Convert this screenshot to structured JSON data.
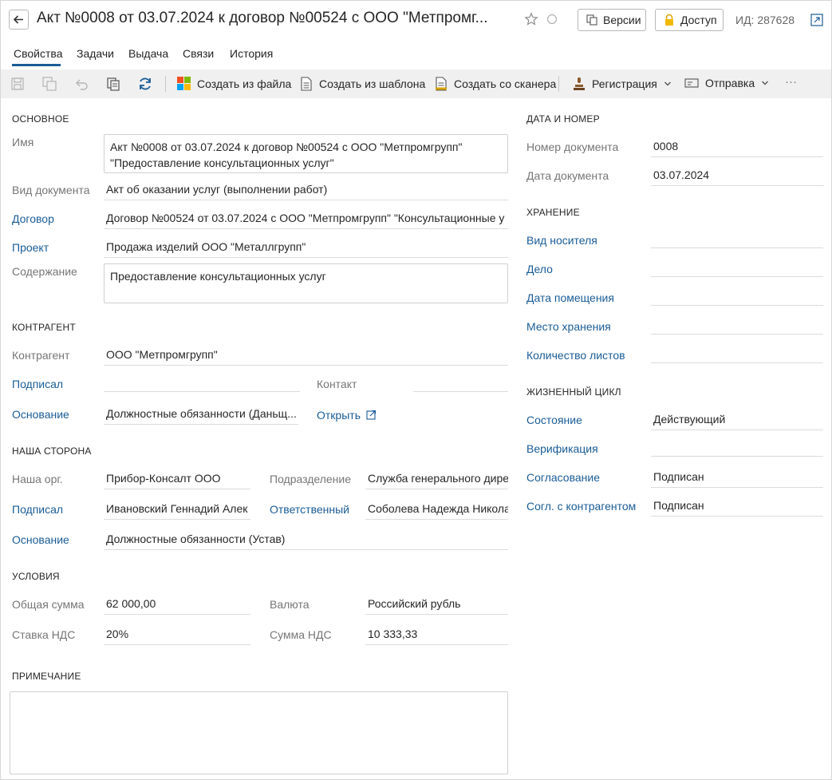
{
  "header": {
    "title": "Акт №0008 от 03.07.2024 к договор №00524 с ООО \"Метпромг...",
    "versions_label": "Версии",
    "access_label": "Доступ",
    "id_text": "ИД: 287628"
  },
  "tabs": [
    {
      "label": "Свойства"
    },
    {
      "label": "Задачи"
    },
    {
      "label": "Выдача"
    },
    {
      "label": "Связи"
    },
    {
      "label": "История"
    }
  ],
  "toolbar": {
    "create_from_file": "Создать из файла",
    "create_from_template": "Создать из шаблона",
    "create_from_scanner": "Создать со сканера",
    "registration": "Регистрация",
    "sending": "Отправка",
    "more": "···"
  },
  "basic": {
    "section": "ОСНОВНОЕ",
    "name_label": "Имя",
    "name_line1": "Акт №0008 от 03.07.2024 к договор №00524 с ООО \"Метпромгрупп\"",
    "name_line2": "\"Предоставление консультационных услуг\"",
    "doc_kind_label": "Вид документа",
    "doc_kind_value": "Акт об оказании услуг (выполнении работ)",
    "contract_label": "Договор",
    "contract_value": "Договор №00524 от 03.07.2024 с ООО \"Метпромгрупп\" \"Консультационные у",
    "project_label": "Проект",
    "project_value": "Продажа изделий ООО \"Металлгрупп\"",
    "content_label": "Содержание",
    "content_value": "Предоставление консультационных услуг"
  },
  "counterparty": {
    "section": "КОНТРАГЕНТ",
    "counterparty_label": "Контрагент",
    "counterparty_value": "ООО \"Метпромгрупп\"",
    "signed_label": "Подписал",
    "signed_value": "",
    "contact_label": "Контакт",
    "contact_value": "",
    "basis_label": "Основание",
    "basis_value": "Должностные обязанности (Даньщ...",
    "open_label": "Открыть"
  },
  "our_side": {
    "section": "НАША СТОРОНА",
    "org_label": "Наша орг.",
    "org_value": "Прибор-Консалт ООО",
    "department_label": "Подразделение",
    "department_value": "Служба генерального дире",
    "signed_label": "Подписал",
    "signed_value": "Ивановский Геннадий Алек",
    "responsible_label": "Ответственный",
    "responsible_value": "Соболева Надежда Никола",
    "basis_label": "Основание",
    "basis_value": "Должностные обязанности (Устав)"
  },
  "conditions": {
    "section": "УСЛОВИЯ",
    "total_label": "Общая сумма",
    "total_value": "62 000,00",
    "currency_label": "Валюта",
    "currency_value": "Российский рубль",
    "vat_rate_label": "Ставка НДС",
    "vat_rate_value": "20%",
    "vat_sum_label": "Сумма НДС",
    "vat_sum_value": "10 333,33"
  },
  "note": {
    "section": "ПРИМЕЧАНИЕ",
    "value": ""
  },
  "date_number": {
    "section": "ДАТА И НОМЕР",
    "number_label": "Номер документа",
    "number_value": "0008",
    "date_label": "Дата документа",
    "date_value": "03.07.2024"
  },
  "storage": {
    "section": "ХРАНЕНИЕ",
    "medium_label": "Вид носителя",
    "case_label": "Дело",
    "placement_date_label": "Дата помещения",
    "location_label": "Место хранения",
    "sheets_label": "Количество листов"
  },
  "lifecycle": {
    "section": "ЖИЗНЕННЫЙ ЦИКЛ",
    "state_label": "Состояние",
    "state_value": "Действующий",
    "verification_label": "Верификация",
    "verification_value": "",
    "approval_label": "Согласование",
    "approval_value": "Подписан",
    "cp_approval_label": "Согл. с контрагентом",
    "cp_approval_value": "Подписан"
  },
  "colors": {
    "link": "#1a5c96",
    "toolbar_bg": "#f0f0f0",
    "label": "#767676"
  }
}
